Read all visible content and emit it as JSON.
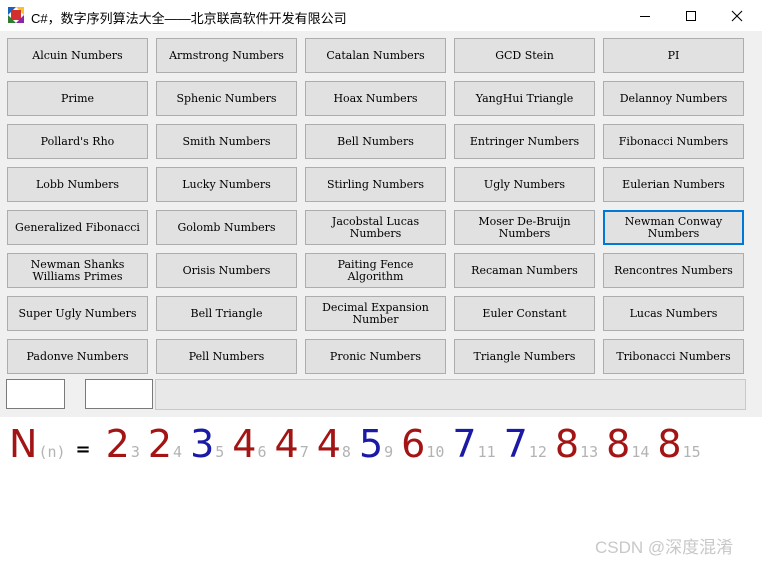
{
  "window": {
    "title": "C#，数字序列算法大全——北京联高软件开发有限公司",
    "minimize_label": "minimize",
    "maximize_label": "maximize",
    "close_label": "close"
  },
  "buttons": [
    [
      "Alcuin Numbers",
      "Armstrong Numbers",
      "Catalan Numbers",
      "GCD Stein",
      "PI"
    ],
    [
      "Prime",
      "Sphenic Numbers",
      "Hoax Numbers",
      "YangHui Triangle",
      "Delannoy Numbers"
    ],
    [
      "Pollard's Rho",
      "Smith Numbers",
      "Bell Numbers",
      "Entringer Numbers",
      "Fibonacci Numbers"
    ],
    [
      "Lobb Numbers",
      "Lucky Numbers",
      "Stirling Numbers",
      "Ugly Numbers",
      "Eulerian Numbers"
    ],
    [
      "Generalized Fibonacci",
      "Golomb Numbers",
      "Jacobstal Lucas Numbers",
      "Moser De-Bruijn Numbers",
      "Newman Conway Numbers"
    ],
    [
      "Newman Shanks Williams Primes",
      "Orisis Numbers",
      "Paiting Fence Algorithm",
      "Recaman Numbers",
      "Rencontres Numbers"
    ],
    [
      "Super Ugly Numbers",
      "Bell Triangle",
      "Decimal Expansion Number",
      "Euler Constant",
      "Lucas Numbers"
    ],
    [
      "Padonve Numbers",
      "Pell Numbers",
      "Pronic Numbers",
      "Triangle Numbers",
      "Tribonacci Numbers"
    ]
  ],
  "focused_button": "Newman Conway Numbers",
  "inputs": {
    "first_value": "",
    "second_value": ""
  },
  "result": {
    "label": "N",
    "label_sub": "(n)",
    "equals": "=",
    "terms": [
      {
        "value": "2",
        "index": "3",
        "color": "#a31515"
      },
      {
        "value": "2",
        "index": "4",
        "color": "#a31515"
      },
      {
        "value": "3",
        "index": "5",
        "color": "#1a1aa6"
      },
      {
        "value": "4",
        "index": "6",
        "color": "#a31515"
      },
      {
        "value": "4",
        "index": "7",
        "color": "#a31515"
      },
      {
        "value": "4",
        "index": "8",
        "color": "#a31515"
      },
      {
        "value": "5",
        "index": "9",
        "color": "#1a1aa6"
      },
      {
        "value": "6",
        "index": "10",
        "color": "#a31515"
      },
      {
        "value": "7",
        "index": "11",
        "color": "#1a1aa6"
      },
      {
        "value": "7",
        "index": "12",
        "color": "#1a1aa6"
      },
      {
        "value": "8",
        "index": "13",
        "color": "#a31515"
      },
      {
        "value": "8",
        "index": "14",
        "color": "#a31515"
      },
      {
        "value": "8",
        "index": "15",
        "color": "#a31515"
      }
    ]
  },
  "watermark": "CSDN @深度混淆",
  "colors": {
    "accent": "#0078d7",
    "term_red": "#a31515",
    "term_blue": "#1a1aa6",
    "index_gray": "#b3b3b3"
  }
}
